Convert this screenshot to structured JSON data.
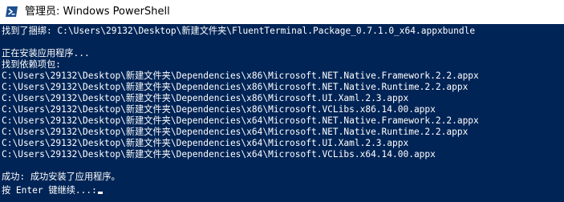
{
  "window": {
    "title": "管理员: Windows PowerShell",
    "icon": "powershell-icon",
    "background": "#012456",
    "text_color": "#ffffff"
  },
  "console": {
    "lines": [
      "找到了捆绑: C:\\Users\\29132\\Desktop\\新建文件夹\\FluentTerminal.Package_0.7.1.0_x64.appxbundle",
      "",
      "正在安装应用程序...",
      "找到依赖项包:",
      "C:\\Users\\29132\\Desktop\\新建文件夹\\Dependencies\\x86\\Microsoft.NET.Native.Framework.2.2.appx",
      "C:\\Users\\29132\\Desktop\\新建文件夹\\Dependencies\\x86\\Microsoft.NET.Native.Runtime.2.2.appx",
      "C:\\Users\\29132\\Desktop\\新建文件夹\\Dependencies\\x86\\Microsoft.UI.Xaml.2.3.appx",
      "C:\\Users\\29132\\Desktop\\新建文件夹\\Dependencies\\x86\\Microsoft.VCLibs.x86.14.00.appx",
      "C:\\Users\\29132\\Desktop\\新建文件夹\\Dependencies\\x64\\Microsoft.NET.Native.Framework.2.2.appx",
      "C:\\Users\\29132\\Desktop\\新建文件夹\\Dependencies\\x64\\Microsoft.NET.Native.Runtime.2.2.appx",
      "C:\\Users\\29132\\Desktop\\新建文件夹\\Dependencies\\x64\\Microsoft.UI.Xaml.2.3.appx",
      "C:\\Users\\29132\\Desktop\\新建文件夹\\Dependencies\\x64\\Microsoft.VCLibs.x64.14.00.appx",
      "",
      "成功: 成功安装了应用程序。",
      "按 Enter 键继续...:"
    ]
  }
}
